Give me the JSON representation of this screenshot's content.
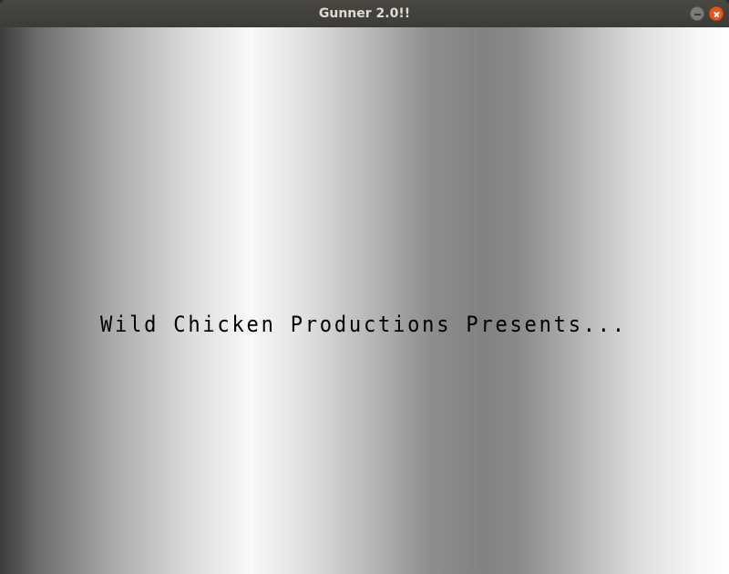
{
  "window": {
    "title": "Gunner 2.0!!"
  },
  "game": {
    "intro_text": "Wild Chicken Productions Presents..."
  },
  "icons": {
    "minimize": "minimize-icon",
    "close": "close-icon"
  },
  "colors": {
    "titlebar": "#3c3b37",
    "title_text": "#dfdbd2",
    "close_button": "#e95420",
    "text": "#000000"
  }
}
